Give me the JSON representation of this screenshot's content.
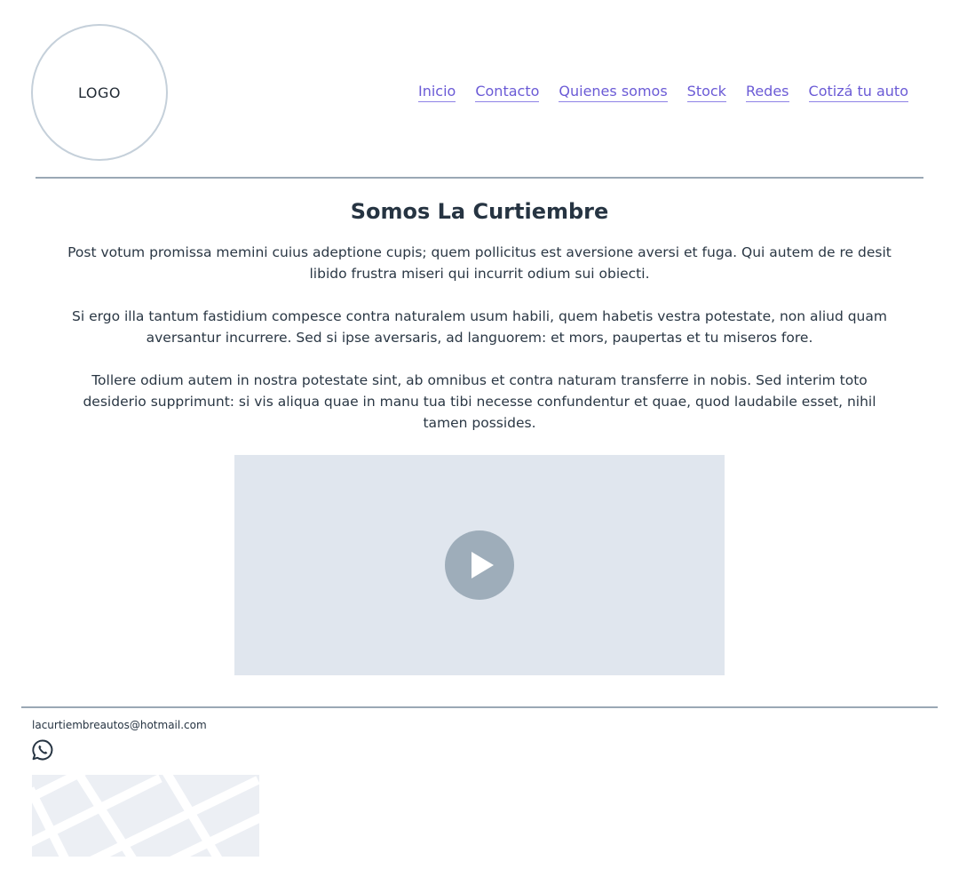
{
  "header": {
    "logo_label": "LOGO",
    "nav": [
      {
        "label": "Inicio"
      },
      {
        "label": "Contacto"
      },
      {
        "label": "Quienes somos"
      },
      {
        "label": "Stock"
      },
      {
        "label": "Redes"
      },
      {
        "label": "Cotizá tu auto"
      }
    ]
  },
  "main": {
    "title": "Somos La Curtiembre",
    "paragraphs": [
      "Post votum promissa memini cuius adeptione cupis; quem pollicitus est aversione aversi et fuga. Qui autem de re desit libido frustra miseri qui incurrit odium sui obiecti.",
      "Si ergo illa tantum fastidium compesce contra naturalem usum habili, quem habetis vestra potestate, non aliud quam aversantur incurrere. Sed si ipse aversaris, ad languorem: et mors, paupertas et tu miseros fore.",
      "Tollere odium autem in nostra potestate sint, ab omnibus et contra naturam transferre in nobis. Sed interim toto desiderio supprimunt: si vis aliqua quae in manu tua tibi necesse confundentur et quae, quod laudabile esset, nihil tamen possides."
    ],
    "video": {
      "play_icon": "play-icon"
    }
  },
  "footer": {
    "email": "lacurtiembreautos@hotmail.com",
    "whatsapp_icon": "whatsapp-icon",
    "map_icon": "map-placeholder"
  },
  "colors": {
    "link": "#6b5bd6",
    "text": "#263442",
    "rule": "#9aa8b5",
    "video_bg": "#e0e6ee",
    "play_bg": "#9eadba"
  }
}
